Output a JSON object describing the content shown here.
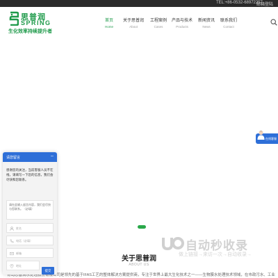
{
  "topbar": {
    "phone": "TEL:+86-0532-68972257",
    "mail": "邮箱登陆"
  },
  "logo": {
    "name_cn": "思普润",
    "name_en": "SPRING",
    "slogan": "生化效率持续提升者",
    "color": "#1e9a4a"
  },
  "nav": {
    "items": [
      {
        "cn": "首页",
        "en": "Home",
        "active": true
      },
      {
        "cn": "关于思普润",
        "en": "About",
        "active": false
      },
      {
        "cn": "工程案例",
        "en": "Cases",
        "active": false
      },
      {
        "cn": "产品与技术",
        "en": "Products",
        "active": false
      },
      {
        "cn": "新闻资讯",
        "en": "News",
        "active": false
      },
      {
        "cn": "联系我们",
        "en": "Contact",
        "active": false
      }
    ],
    "search_icon": "search-icon"
  },
  "about": {
    "title": "关于思普润",
    "subtitle": "ABOUT US",
    "text": "青岛思普润水处理股份有限公司是领先的基于IFAS工艺的整体解决方案提供商，专注于世界上最大生化技术之一——生物膜水处理技术领域，在市政污水、工业"
  },
  "watermark": {
    "main": "自动秒收录",
    "sub": "做上链接→来访一次→自动收录→"
  },
  "online_service": {
    "label": "在线客服"
  },
  "chat": {
    "title": "请您留言",
    "close": "–",
    "message": "感谢您的关注，当前客服人员不在线，请填写一下您的信息，我们会尽快和您联系。",
    "textarea_placeholder": "请在此输入留言内容，我们会尽快与您联系。（必填）",
    "fields": [
      {
        "placeholder": "姓名",
        "icon": "user-icon"
      },
      {
        "placeholder": "电话（必填）",
        "icon": "phone-icon"
      },
      {
        "placeholder": "邮箱",
        "icon": "email-icon"
      },
      {
        "placeholder": "地址",
        "icon": "location-icon"
      }
    ],
    "submit": "提交"
  },
  "colors": {
    "brand_green": "#1e9a4a",
    "chat_blue": "#2e6fd8",
    "slider_active": "#2aa84a",
    "topbar_bg": "#2a2a2a"
  }
}
